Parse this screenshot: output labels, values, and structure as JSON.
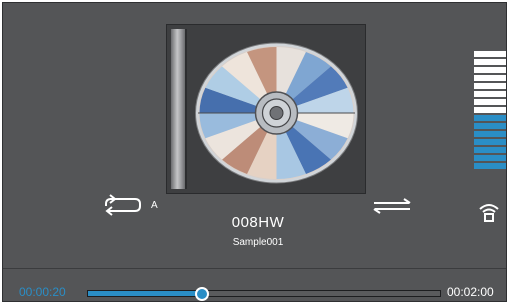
{
  "track": {
    "title": "008HW",
    "artist": "Sample001"
  },
  "playback": {
    "current_time": "00:00:20",
    "total_time": "00:02:00",
    "progress_fraction": 0.32
  },
  "repeat": {
    "icon": "repeat-icon",
    "mode_label": "A"
  },
  "shuffle": {
    "icon": "shuffle-icon"
  },
  "volume": {
    "level_fraction": 0.47,
    "segment_count": 15,
    "icon": "speaker-icon"
  },
  "colors": {
    "accent": "#2a8ec6",
    "background": "#545557",
    "volume_inactive": "#ffffff"
  }
}
